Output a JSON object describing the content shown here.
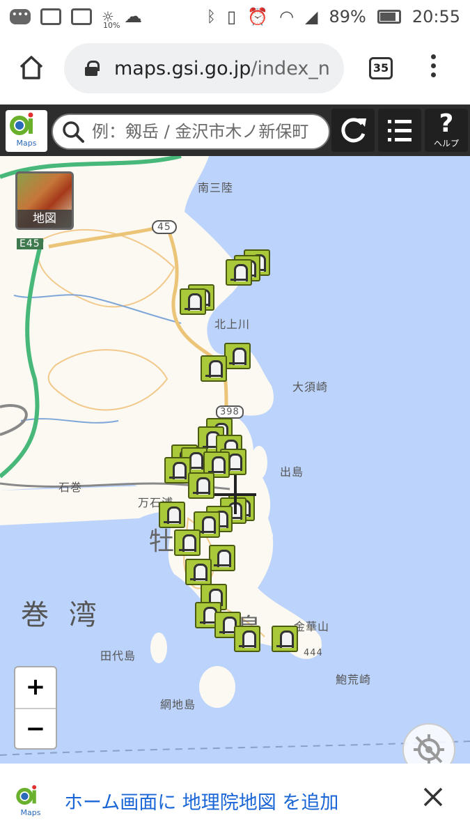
{
  "status_bar": {
    "icons": [
      "message-icon",
      "gmail-icon",
      "news-icon",
      "weather-icon",
      "cloud-icon",
      "bluetooth-icon",
      "vibrate-icon",
      "alarm-icon",
      "wifi-icon",
      "signal-icon"
    ],
    "weather_pct": "10%",
    "battery": "89%",
    "time": "20:55"
  },
  "browser": {
    "url_host": "maps.gsi.go.jp",
    "url_path": "/index_n",
    "tab_count": "35"
  },
  "toolbar": {
    "logo_text": "Maps",
    "search_placeholder": "例：剱岳 / 金沢市木ノ新保町",
    "help_label": "ヘルプ"
  },
  "map": {
    "layer_button_label": "地図",
    "places": {
      "minamisanriku": "南三陸",
      "kitakami": "北上川",
      "osuzaki": "大須崎",
      "ishinomaki": "石巻",
      "izushima": "出島",
      "mangokuura": "万石浦",
      "kinkasan": "金華山",
      "tashirojima": "田代島",
      "height_444": "444",
      "ajishima": "網地島",
      "kuroasaki": "鮑荒崎",
      "route_398": "398",
      "road_45": "45",
      "expressway": "E45",
      "bay": "巻 湾",
      "peninsula_1": "牡",
      "peninsula_2": "鹿",
      "peninsula_3": "島"
    },
    "zoom_in": "+",
    "zoom_out": "−",
    "marker_type": "memorial-monument",
    "marker_count": 27
  },
  "banner": {
    "logo_text": "Maps",
    "text": "ホーム画面に 地理院地図 を追加"
  },
  "colors": {
    "sea": "#bcd3fb",
    "land": "#fbf9f1",
    "marker": "#a9c93a",
    "link": "#1a66d6",
    "toolbar": "#2d2d2d"
  }
}
